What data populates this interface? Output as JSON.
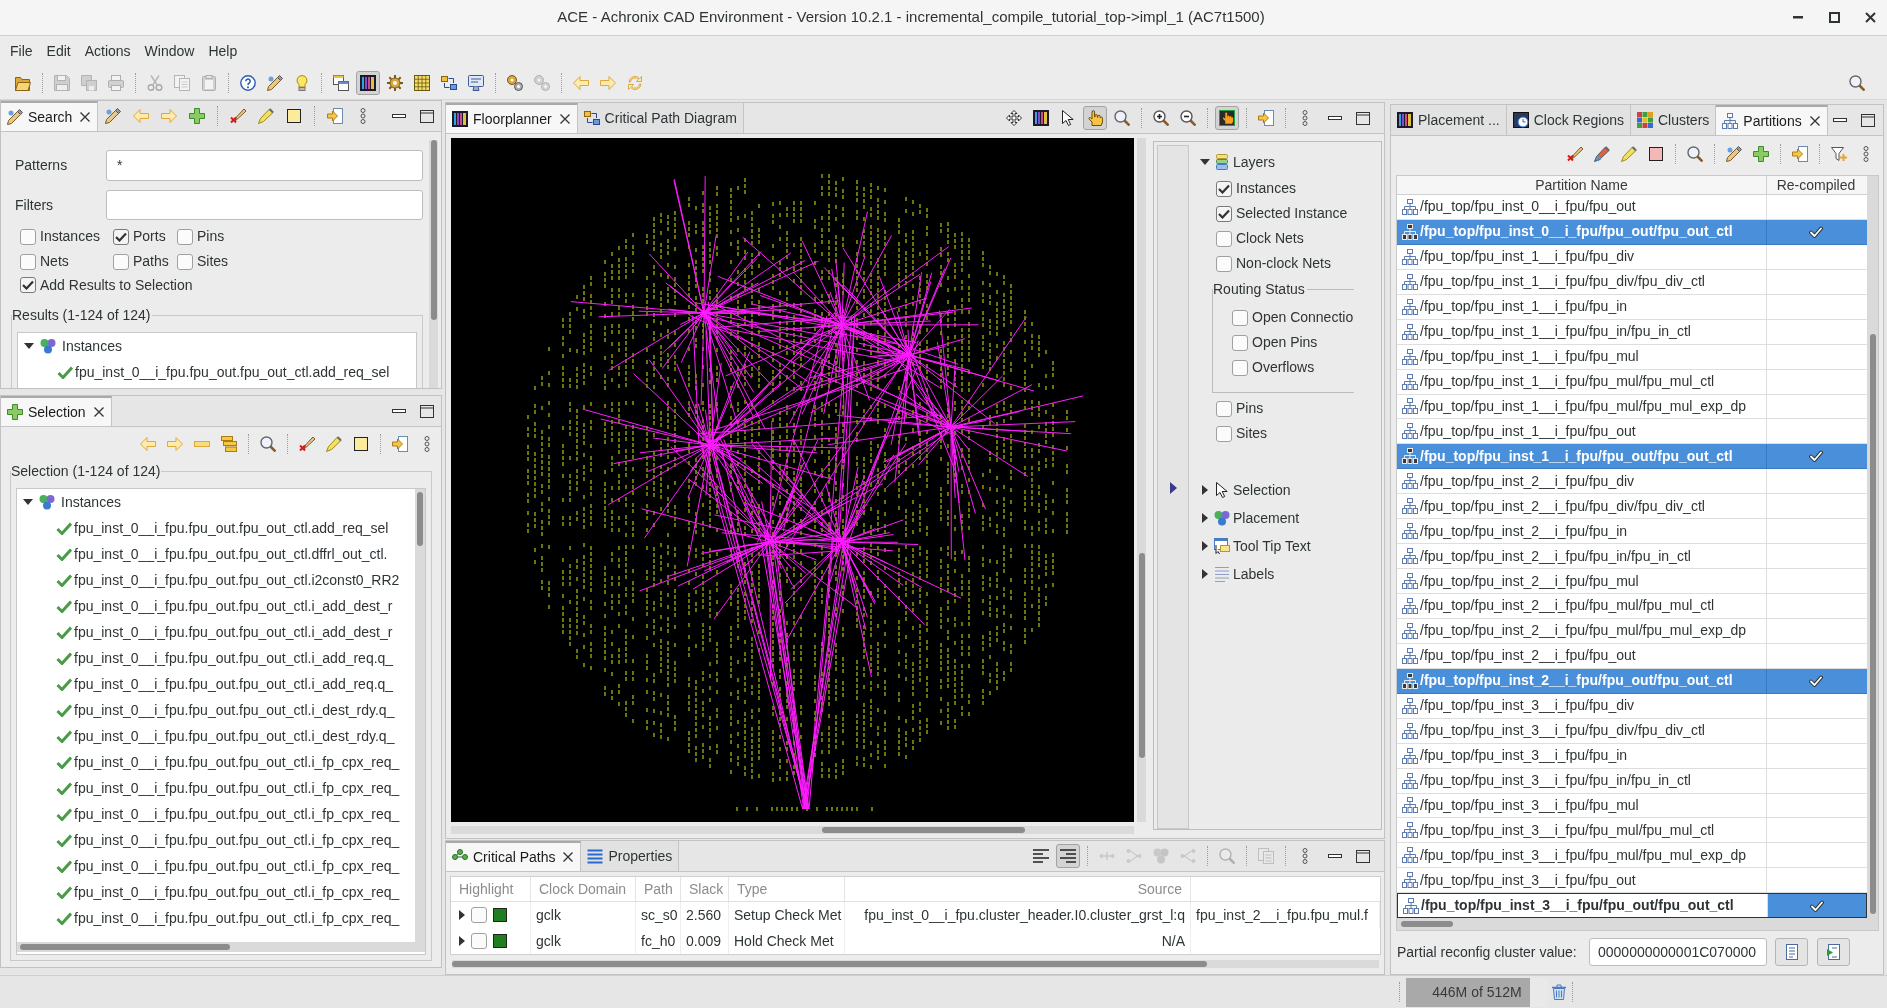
{
  "window": {
    "title": "ACE - Achronix CAD Environment - Version 10.2.1 - incremental_compile_tutorial_top->impl_1 (AC7t1500)"
  },
  "menu": [
    "File",
    "Edit",
    "Actions",
    "Window",
    "Help"
  ],
  "toolbar": [
    [
      {
        "kind": "folder",
        "disabled": false,
        "pressed": false
      }
    ],
    [
      {
        "kind": "save",
        "disabled": true,
        "pressed": false
      },
      {
        "kind": "saveall",
        "disabled": true,
        "pressed": false
      },
      {
        "kind": "print",
        "disabled": true,
        "pressed": false
      }
    ],
    [
      {
        "kind": "cut",
        "disabled": true,
        "pressed": false
      },
      {
        "kind": "copy",
        "disabled": true,
        "pressed": false
      },
      {
        "kind": "paste",
        "disabled": true,
        "pressed": false
      }
    ],
    [
      {
        "kind": "help",
        "disabled": false,
        "pressed": false
      },
      {
        "kind": "tool",
        "disabled": false,
        "pressed": false
      },
      {
        "kind": "bulb",
        "disabled": false,
        "pressed": false
      }
    ],
    [
      {
        "kind": "windows",
        "disabled": false,
        "pressed": false
      },
      {
        "kind": "floorplan",
        "disabled": false,
        "pressed": true
      },
      {
        "kind": "gear",
        "disabled": false,
        "pressed": false
      },
      {
        "kind": "grid",
        "disabled": false,
        "pressed": false
      },
      {
        "kind": "swap",
        "disabled": false,
        "pressed": false
      },
      {
        "kind": "monitor",
        "disabled": false,
        "pressed": false
      }
    ],
    [
      {
        "kind": "gears",
        "disabled": false,
        "pressed": false
      },
      {
        "kind": "gears",
        "disabled": true,
        "pressed": false
      }
    ],
    [
      {
        "kind": "back",
        "disabled": false,
        "pressed": false
      },
      {
        "kind": "forward",
        "disabled": false,
        "pressed": false
      },
      {
        "kind": "sync",
        "disabled": false,
        "pressed": false
      }
    ]
  ],
  "search": {
    "tabs": [
      {
        "label": "Search",
        "selected": true
      }
    ],
    "patterns": {
      "label": "Patterns",
      "value": "*"
    },
    "filters": {
      "label": "Filters"
    },
    "options": [
      {
        "label": "Instances",
        "checked": false
      },
      {
        "label": "Ports",
        "checked": true
      },
      {
        "label": "Pins",
        "checked": false
      },
      {
        "label": "Nets",
        "checked": false
      },
      {
        "label": "Paths",
        "checked": false
      },
      {
        "label": "Sites",
        "checked": false
      }
    ],
    "add_to_selection": {
      "label": "Add Results to Selection",
      "checked": true
    },
    "results": {
      "label": "Results (1-124 of 124)",
      "tree": [
        {
          "label": "Instances",
          "expanded": true,
          "children": [
            {
              "label": "fpu_inst_0__i_fpu.fpu_out.fpu_out_ctl.add_req_sel"
            }
          ]
        }
      ]
    }
  },
  "selection": {
    "tabs": [
      {
        "label": "Selection",
        "selected": true
      }
    ],
    "label": "Selection (1-124 of 124)",
    "tree": [
      {
        "label": "Instances",
        "expanded": true,
        "children": [
          {
            "label": "fpu_inst_0__i_fpu.fpu_out.fpu_out_ctl.add_req_sel"
          },
          {
            "label": "fpu_inst_0__i_fpu.fpu_out.fpu_out_ctl.dffrl_out_ctl."
          },
          {
            "label": "fpu_inst_0__i_fpu.fpu_out.fpu_out_ctl.i2const0_RR2"
          },
          {
            "label": "fpu_inst_0__i_fpu.fpu_out.fpu_out_ctl.i_add_dest_r"
          },
          {
            "label": "fpu_inst_0__i_fpu.fpu_out.fpu_out_ctl.i_add_dest_r"
          },
          {
            "label": "fpu_inst_0__i_fpu.fpu_out.fpu_out_ctl.i_add_req.q_"
          },
          {
            "label": "fpu_inst_0__i_fpu.fpu_out.fpu_out_ctl.i_add_req.q_"
          },
          {
            "label": "fpu_inst_0__i_fpu.fpu_out.fpu_out_ctl.i_dest_rdy.q_"
          },
          {
            "label": "fpu_inst_0__i_fpu.fpu_out.fpu_out_ctl.i_dest_rdy.q_"
          },
          {
            "label": "fpu_inst_0__i_fpu.fpu_out.fpu_out_ctl.i_fp_cpx_req_"
          },
          {
            "label": "fpu_inst_0__i_fpu.fpu_out.fpu_out_ctl.i_fp_cpx_req_"
          },
          {
            "label": "fpu_inst_0__i_fpu.fpu_out.fpu_out_ctl.i_fp_cpx_req_"
          },
          {
            "label": "fpu_inst_0__i_fpu.fpu_out.fpu_out_ctl.i_fp_cpx_req_"
          },
          {
            "label": "fpu_inst_0__i_fpu.fpu_out.fpu_out_ctl.i_fp_cpx_req_"
          },
          {
            "label": "fpu_inst_0__i_fpu.fpu_out.fpu_out_ctl.i_fp_cpx_req_"
          },
          {
            "label": "fpu_inst_0__i_fpu.fpu_out.fpu_out_ctl.i_fp_cpx_req_"
          }
        ]
      }
    ]
  },
  "floorplanner": {
    "tabs": [
      {
        "label": "Floorplanner",
        "selected": true
      },
      {
        "label": "Critical Path Diagram",
        "selected": false
      }
    ],
    "toolbar": [
      [
        {
          "kind": "move",
          "disabled": false,
          "pressed": false
        },
        {
          "kind": "floorplan",
          "disabled": false,
          "pressed": false
        },
        {
          "kind": "cursor",
          "disabled": false,
          "pressed": false
        },
        {
          "kind": "hand",
          "disabled": false,
          "pressed": true
        },
        {
          "kind": "search",
          "disabled": false,
          "pressed": false
        }
      ],
      [
        {
          "kind": "zoomin",
          "disabled": false,
          "pressed": false
        },
        {
          "kind": "zoomout",
          "disabled": false,
          "pressed": false
        }
      ],
      [
        {
          "kind": "handframe",
          "disabled": false,
          "pressed": true
        }
      ],
      [
        {
          "kind": "export",
          "disabled": false,
          "pressed": false
        }
      ]
    ],
    "layer_tree": [
      {
        "label": "Layers",
        "expanded": true,
        "children": [
          {
            "kind": "checkbox",
            "label": "Instances",
            "checked": true
          },
          {
            "kind": "checkbox",
            "label": "Selected Instance",
            "checked": true
          },
          {
            "kind": "checkbox",
            "label": "Clock Nets",
            "checked": false
          },
          {
            "kind": "checkbox",
            "label": "Non-clock Nets",
            "checked": false
          },
          {
            "kind": "group",
            "label": "Routing Status",
            "children": [
              {
                "kind": "checkbox",
                "label": "Open Connectio",
                "checked": false
              },
              {
                "kind": "checkbox",
                "label": "Open Pins",
                "checked": false
              },
              {
                "kind": "checkbox",
                "label": "Overflows",
                "checked": false
              }
            ]
          },
          {
            "kind": "checkbox",
            "label": "Pins",
            "checked": false
          },
          {
            "kind": "checkbox",
            "label": "Sites",
            "checked": false
          }
        ]
      },
      {
        "label": "Selection",
        "expanded": false
      },
      {
        "label": "Placement",
        "expanded": false
      },
      {
        "label": "Tool Tip Text",
        "expanded": false
      },
      {
        "label": "Labels",
        "expanded": false
      }
    ]
  },
  "critical_paths": {
    "tabs": [
      {
        "label": "Critical Paths",
        "selected": true
      },
      {
        "label": "Properties",
        "selected": false
      }
    ],
    "toolbar": [
      [
        {
          "kind": "alignl",
          "disabled": false,
          "pressed": false
        },
        {
          "kind": "alignr",
          "disabled": false,
          "pressed": true
        }
      ],
      [
        {
          "kind": "path1",
          "disabled": true,
          "pressed": false
        },
        {
          "kind": "path2",
          "disabled": true,
          "pressed": false
        },
        {
          "kind": "path3",
          "disabled": true,
          "pressed": false
        },
        {
          "kind": "path4",
          "disabled": true,
          "pressed": false
        }
      ],
      [
        {
          "kind": "search",
          "disabled": true,
          "pressed": false
        }
      ],
      [
        {
          "kind": "docs",
          "disabled": true,
          "pressed": false
        }
      ]
    ],
    "columns": [
      "Highlight",
      "Clock Domain",
      "Path",
      "Slack",
      "Type",
      "Source"
    ],
    "rows": [
      {
        "expanded": false,
        "highlight": false,
        "color": "#1f7f1f",
        "cells": [
          "",
          "gclk",
          "sc_s0",
          "2.560",
          "Setup Check Met",
          "fpu_inst_0__i_fpu.cluster_header.I0.cluster_grst_l:q",
          "fpu_inst_2__i_fpu.fpu_mul.f"
        ]
      },
      {
        "expanded": false,
        "highlight": false,
        "color": "#1f7f1f",
        "cells": [
          "",
          "gclk",
          "fc_h0",
          "0.009",
          "Hold Check Met",
          "N/A"
        ]
      }
    ]
  },
  "partitions": {
    "tabs": [
      {
        "label": "Placement ...",
        "selected": false
      },
      {
        "label": "Clock Regions",
        "selected": false
      },
      {
        "label": "Clusters",
        "selected": false
      },
      {
        "label": "Partitions",
        "selected": true
      }
    ],
    "columns": [
      "Partition Name",
      "Re-compiled"
    ],
    "rows": [
      {
        "name": "/fpu_top/fpu_inst_0__i_fpu/fpu_out",
        "selected": false,
        "focused": false,
        "recompiled": false
      },
      {
        "name": "/fpu_top/fpu_inst_0__i_fpu/fpu_out/fpu_out_ctl",
        "selected": true,
        "focused": false,
        "recompiled": true
      },
      {
        "name": "/fpu_top/fpu_inst_1__i_fpu/fpu_div",
        "selected": false,
        "focused": false,
        "recompiled": false
      },
      {
        "name": "/fpu_top/fpu_inst_1__i_fpu/fpu_div/fpu_div_ctl",
        "selected": false,
        "focused": false,
        "recompiled": false
      },
      {
        "name": "/fpu_top/fpu_inst_1__i_fpu/fpu_in",
        "selected": false,
        "focused": false,
        "recompiled": false
      },
      {
        "name": "/fpu_top/fpu_inst_1__i_fpu/fpu_in/fpu_in_ctl",
        "selected": false,
        "focused": false,
        "recompiled": false
      },
      {
        "name": "/fpu_top/fpu_inst_1__i_fpu/fpu_mul",
        "selected": false,
        "focused": false,
        "recompiled": false
      },
      {
        "name": "/fpu_top/fpu_inst_1__i_fpu/fpu_mul/fpu_mul_ctl",
        "selected": false,
        "focused": false,
        "recompiled": false
      },
      {
        "name": "/fpu_top/fpu_inst_1__i_fpu/fpu_mul/fpu_mul_exp_dp",
        "selected": false,
        "focused": false,
        "recompiled": false
      },
      {
        "name": "/fpu_top/fpu_inst_1__i_fpu/fpu_out",
        "selected": false,
        "focused": false,
        "recompiled": false
      },
      {
        "name": "/fpu_top/fpu_inst_1__i_fpu/fpu_out/fpu_out_ctl",
        "selected": true,
        "focused": false,
        "recompiled": true
      },
      {
        "name": "/fpu_top/fpu_inst_2__i_fpu/fpu_div",
        "selected": false,
        "focused": false,
        "recompiled": false
      },
      {
        "name": "/fpu_top/fpu_inst_2__i_fpu/fpu_div/fpu_div_ctl",
        "selected": false,
        "focused": false,
        "recompiled": false
      },
      {
        "name": "/fpu_top/fpu_inst_2__i_fpu/fpu_in",
        "selected": false,
        "focused": false,
        "recompiled": false
      },
      {
        "name": "/fpu_top/fpu_inst_2__i_fpu/fpu_in/fpu_in_ctl",
        "selected": false,
        "focused": false,
        "recompiled": false
      },
      {
        "name": "/fpu_top/fpu_inst_2__i_fpu/fpu_mul",
        "selected": false,
        "focused": false,
        "recompiled": false
      },
      {
        "name": "/fpu_top/fpu_inst_2__i_fpu/fpu_mul/fpu_mul_ctl",
        "selected": false,
        "focused": false,
        "recompiled": false
      },
      {
        "name": "/fpu_top/fpu_inst_2__i_fpu/fpu_mul/fpu_mul_exp_dp",
        "selected": false,
        "focused": false,
        "recompiled": false
      },
      {
        "name": "/fpu_top/fpu_inst_2__i_fpu/fpu_out",
        "selected": false,
        "focused": false,
        "recompiled": false
      },
      {
        "name": "/fpu_top/fpu_inst_2__i_fpu/fpu_out/fpu_out_ctl",
        "selected": true,
        "focused": false,
        "recompiled": true
      },
      {
        "name": "/fpu_top/fpu_inst_3__i_fpu/fpu_div",
        "selected": false,
        "focused": false,
        "recompiled": false
      },
      {
        "name": "/fpu_top/fpu_inst_3__i_fpu/fpu_div/fpu_div_ctl",
        "selected": false,
        "focused": false,
        "recompiled": false
      },
      {
        "name": "/fpu_top/fpu_inst_3__i_fpu/fpu_in",
        "selected": false,
        "focused": false,
        "recompiled": false
      },
      {
        "name": "/fpu_top/fpu_inst_3__i_fpu/fpu_in/fpu_in_ctl",
        "selected": false,
        "focused": false,
        "recompiled": false
      },
      {
        "name": "/fpu_top/fpu_inst_3__i_fpu/fpu_mul",
        "selected": false,
        "focused": false,
        "recompiled": false
      },
      {
        "name": "/fpu_top/fpu_inst_3__i_fpu/fpu_mul/fpu_mul_ctl",
        "selected": false,
        "focused": false,
        "recompiled": false
      },
      {
        "name": "/fpu_top/fpu_inst_3__i_fpu/fpu_mul/fpu_mul_exp_dp",
        "selected": false,
        "focused": false,
        "recompiled": false
      },
      {
        "name": "/fpu_top/fpu_inst_3__i_fpu/fpu_out",
        "selected": false,
        "focused": false,
        "recompiled": false
      },
      {
        "name": "/fpu_top/fpu_inst_3__i_fpu/fpu_out/fpu_out_ctl",
        "selected": true,
        "focused": true,
        "recompiled": true
      }
    ],
    "reconfig": {
      "label": "Partial reconfig cluster value:",
      "value": "0000000000001C070000"
    }
  },
  "status_bar": {
    "heap": {
      "reading": "446M of 512M",
      "level": 0.87
    }
  }
}
